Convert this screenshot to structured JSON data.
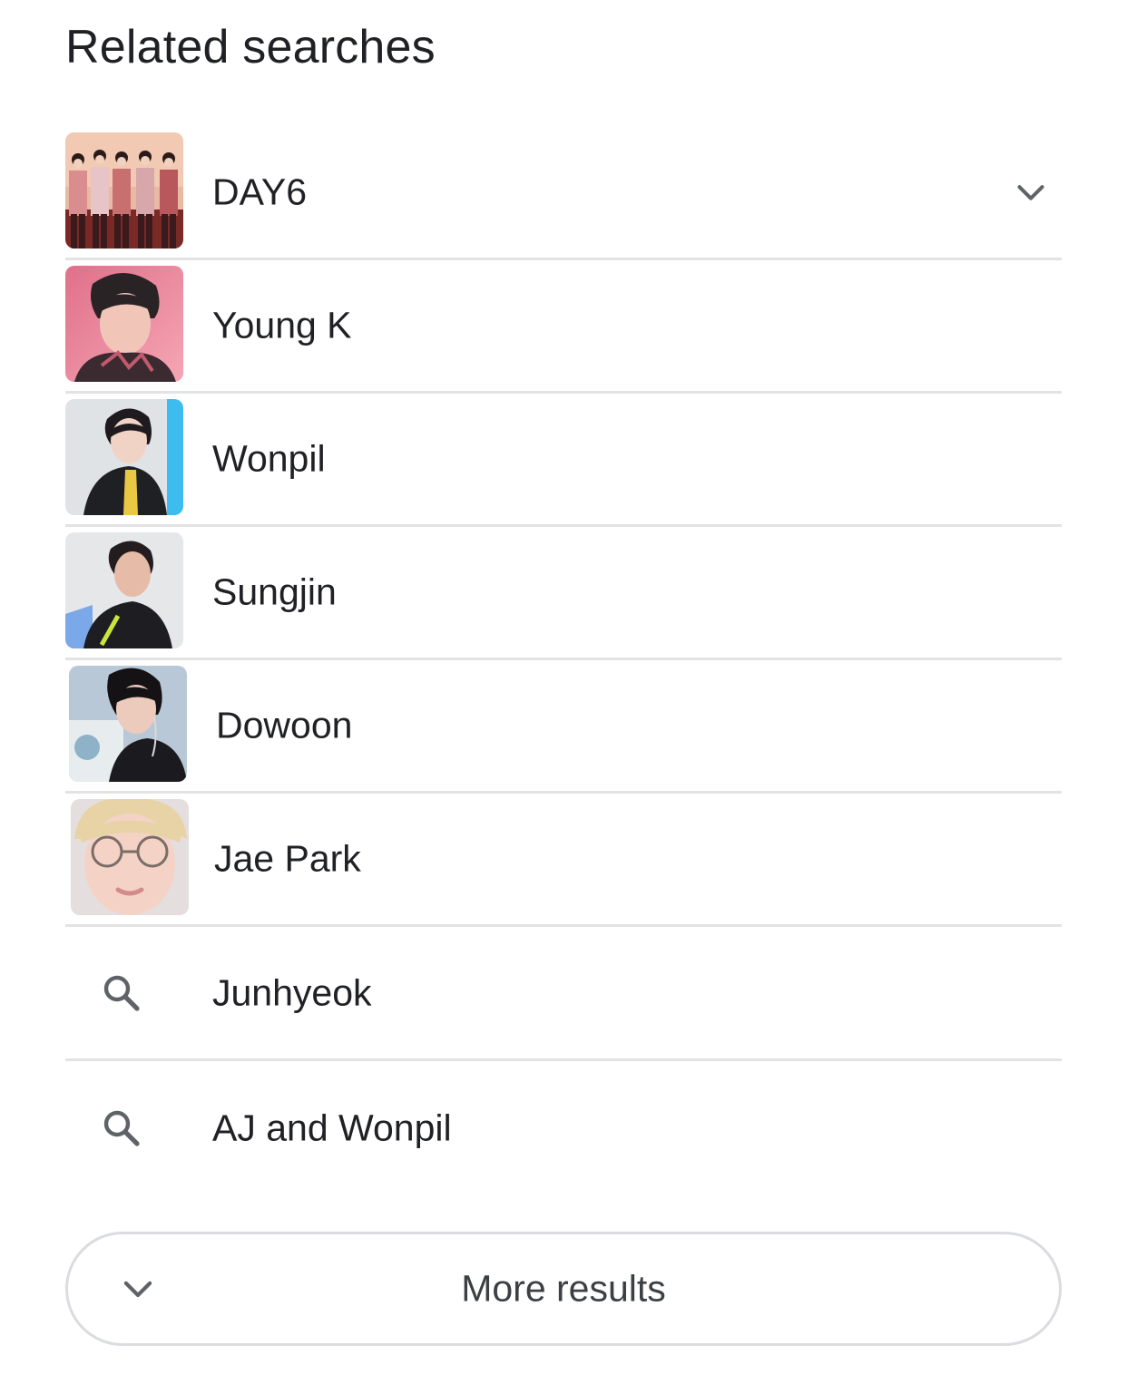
{
  "section": {
    "title": "Related searches"
  },
  "entities": [
    {
      "label": "DAY6",
      "image": "group-photo",
      "expandable": true
    },
    {
      "label": "Young K",
      "image": "person-photo"
    },
    {
      "label": "Wonpil",
      "image": "person-photo"
    },
    {
      "label": "Sungjin",
      "image": "person-photo"
    },
    {
      "label": "Dowoon",
      "image": "person-photo"
    },
    {
      "label": "Jae Park",
      "image": "person-photo"
    }
  ],
  "queries": [
    {
      "label": "Junhyeok",
      "icon": "search-icon"
    },
    {
      "label": "AJ and Wonpil",
      "icon": "search-icon"
    }
  ],
  "more_button": {
    "label": "More results",
    "icon": "chevron-down-icon"
  },
  "colors": {
    "text": "#202124",
    "divider": "#e3e3e3",
    "icon": "#5f6368",
    "button_border": "#dadce0"
  }
}
